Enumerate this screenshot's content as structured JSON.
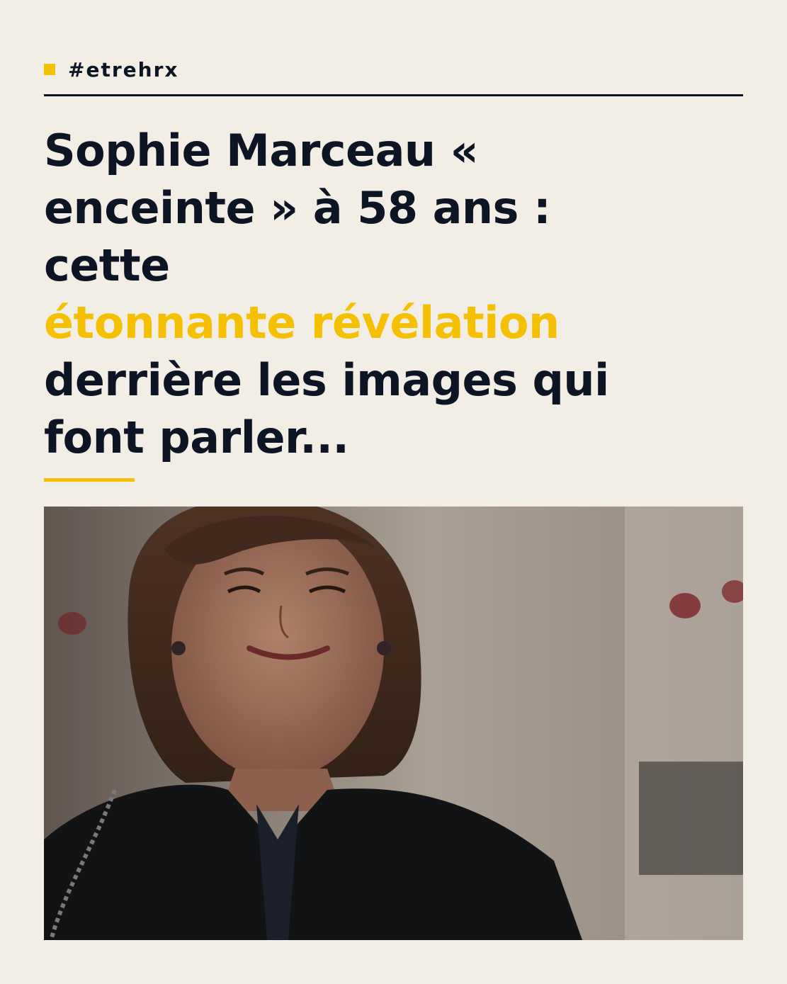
{
  "tag": "#etrehrx",
  "headline": {
    "line1": "Sophie Marceau «",
    "line2": "enceinte » à 58 ans :",
    "line3": "cette",
    "line4_highlight": "étonnante révélation",
    "line5": "derrière les images qui",
    "line6": "font parler..."
  },
  "colors": {
    "background": "#f2eee6",
    "text": "#0d1424",
    "accent": "#f5c000"
  }
}
